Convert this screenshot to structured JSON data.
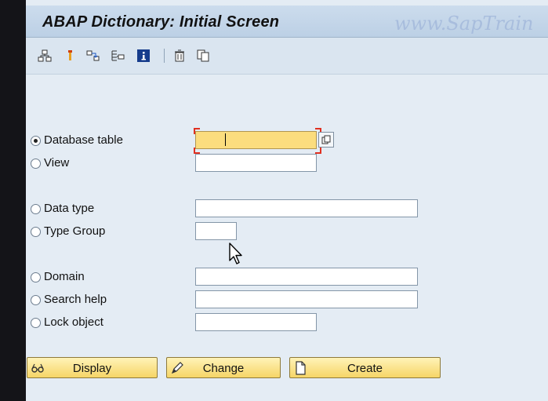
{
  "window": {
    "title": "ABAP Dictionary: Initial Screen",
    "watermark": "www.SapTrain"
  },
  "toolbar": {
    "icons": [
      "hierarchy-icon",
      "where-used-icon",
      "object-list-icon",
      "display-object-list-icon",
      "info-icon",
      "delete-icon",
      "copy-icon"
    ]
  },
  "form": {
    "options": [
      {
        "label": "Database table",
        "selected": true
      },
      {
        "label": "View",
        "selected": false
      },
      {
        "label": "Data type",
        "selected": false
      },
      {
        "label": "Type Group",
        "selected": false
      },
      {
        "label": "Domain",
        "selected": false
      },
      {
        "label": "Search help",
        "selected": false
      },
      {
        "label": "Lock object",
        "selected": false
      }
    ],
    "values": {
      "database_table": "",
      "view": "",
      "data_type": "",
      "type_group": "",
      "domain": "",
      "search_help": "",
      "lock_object": ""
    }
  },
  "buttons": {
    "display": "Display",
    "change": "Change",
    "create": "Create"
  },
  "colors": {
    "button_fill": "#f6d566",
    "focused_field": "#fbdd7e",
    "title_bar": "#c5d7ea",
    "background": "#e4ecf4"
  }
}
